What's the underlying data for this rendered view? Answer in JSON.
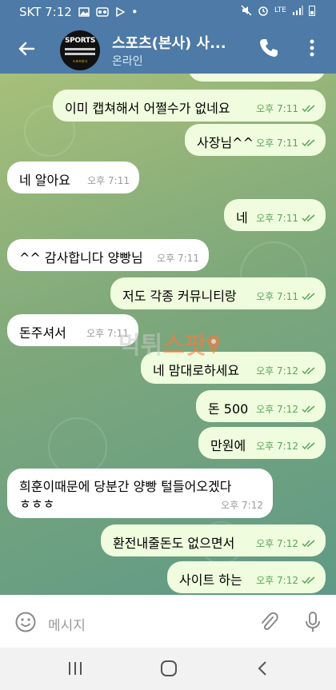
{
  "status_bar": {
    "carrier_time": "SKT 7:12",
    "network": "LTE"
  },
  "header": {
    "title": "스포츠(본사) 사...",
    "status": "온라인",
    "avatar": {
      "text": "SPORTS",
      "sub": "스포츠본사"
    }
  },
  "messages": [
    {
      "dir": "out",
      "text": "이미 캡쳐해서 어쩔수가 없네요",
      "time": "오후 7:11"
    },
    {
      "dir": "out",
      "text": "사장님^^",
      "time": "오후 7:11"
    },
    {
      "dir": "in",
      "text": "네 알아요",
      "time": "오후 7:11"
    },
    {
      "dir": "out",
      "text": "네",
      "time": "오후 7:11"
    },
    {
      "dir": "in",
      "text": "^^ 감사합니다 양빵님",
      "time": "오후 7:11"
    },
    {
      "dir": "out",
      "text": "저도 각종 커뮤니티랑",
      "time": "오후 7:11"
    },
    {
      "dir": "in",
      "text": "돈주셔서",
      "time": "오후 7:11"
    },
    {
      "dir": "out",
      "text": "네 맘대로하세요",
      "time": "오후 7:12"
    },
    {
      "dir": "out",
      "text": "돈 500",
      "time": "오후 7:12"
    },
    {
      "dir": "out",
      "text": "만원에",
      "time": "오후 7:12"
    },
    {
      "dir": "in",
      "text_line1": "희훈이때문에 당분간 양빵 털들어오겠다",
      "text_line2": "ㅎㅎㅎ",
      "time": "오후 7:12"
    },
    {
      "dir": "out",
      "text": "환전내줄돈도 없으면서",
      "time": "오후 7:12"
    },
    {
      "dir": "out",
      "text": "사이트 하는",
      "time": "오후 7:12"
    }
  ],
  "watermark": {
    "left": "먹튀",
    "right": "스팟"
  },
  "input": {
    "placeholder": "메시지"
  },
  "colors": {
    "header": "#4d7aa6",
    "outgoing_bubble": "#effdde",
    "incoming_bubble": "#ffffff",
    "read_ticks": "#5aa55a"
  },
  "icons": [
    "back-arrow-icon",
    "phone-icon",
    "more-vert-icon",
    "emoji-icon",
    "attach-icon",
    "mic-icon",
    "recents-icon",
    "home-icon",
    "nav-back-icon"
  ]
}
